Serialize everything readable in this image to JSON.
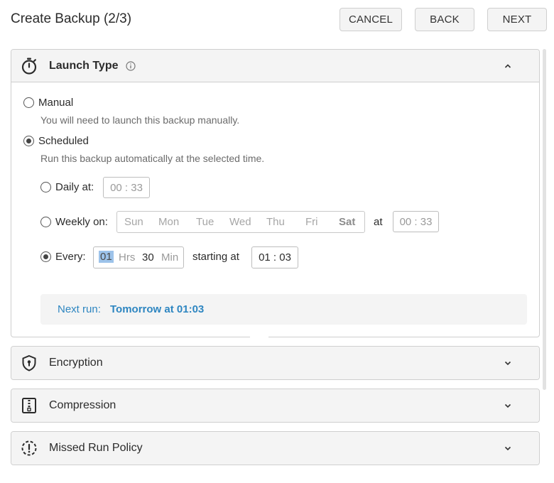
{
  "header": {
    "title": "Create Backup (2/3)",
    "buttons": {
      "cancel": "CANCEL",
      "back": "BACK",
      "next": "NEXT"
    }
  },
  "launch_type": {
    "title": "Launch Type",
    "icon": "stopwatch-icon",
    "expanded": true,
    "manual": {
      "label": "Manual",
      "description": "You will need to launch this backup manually.",
      "checked": false
    },
    "scheduled": {
      "label": "Scheduled",
      "description": "Run this backup automatically at the selected time.",
      "checked": true
    },
    "daily": {
      "label": "Daily at:",
      "time": "00 : 33",
      "checked": false
    },
    "weekly": {
      "label": "Weekly on:",
      "days": [
        "Sun",
        "Mon",
        "Tue",
        "Wed",
        "Thu",
        "Fri",
        "Sat"
      ],
      "selected_day": "Sat",
      "at_label": "at",
      "time": "00 : 33",
      "checked": false
    },
    "every": {
      "label": "Every:",
      "hours": "01",
      "hours_unit": "Hrs",
      "minutes": "30",
      "minutes_unit": "Min",
      "starting_label": "starting at",
      "start_time": "01 : 03",
      "checked": true
    },
    "next_run": {
      "label": "Next run:",
      "value": "Tomorrow at 01:03"
    }
  },
  "sections": [
    {
      "title": "Encryption",
      "icon": "shield-keyhole-icon",
      "expanded": false
    },
    {
      "title": "Compression",
      "icon": "zip-file-icon",
      "expanded": false
    },
    {
      "title": "Missed Run Policy",
      "icon": "dashed-alert-circle-icon",
      "expanded": false
    }
  ],
  "colors": {
    "accent": "#2e86c1",
    "header_bg": "#f4f4f4",
    "border": "#cfcfcf",
    "selection": "#9dc3ea"
  }
}
